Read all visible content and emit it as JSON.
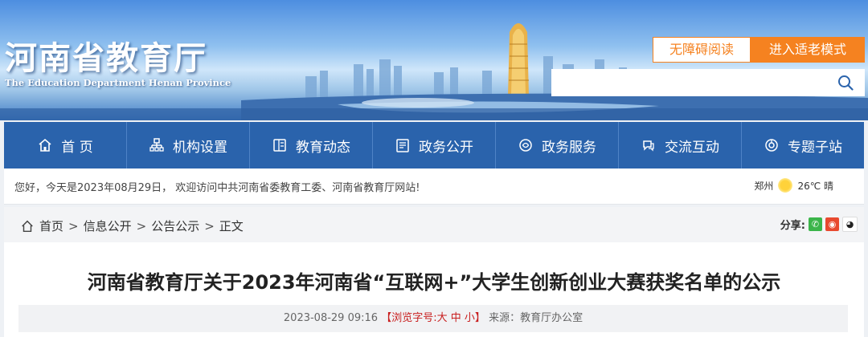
{
  "header": {
    "site_title": "河南省教育厅",
    "site_subtitle": "The Education Department Henan Province",
    "accessibility_button": "无障碍阅读",
    "elder_mode_button": "进入适老模式",
    "search_placeholder": ""
  },
  "nav": {
    "items": [
      {
        "label": "首 页",
        "icon": "home-icon"
      },
      {
        "label": "机构设置",
        "icon": "org-icon"
      },
      {
        "label": "教育动态",
        "icon": "news-icon"
      },
      {
        "label": "政务公开",
        "icon": "document-icon"
      },
      {
        "label": "政务服务",
        "icon": "service-icon"
      },
      {
        "label": "交流互动",
        "icon": "chat-icon"
      },
      {
        "label": "专题子站",
        "icon": "topic-icon"
      }
    ]
  },
  "welcome": {
    "text": "您好，今天是2023年08月29日， 欢迎访问中共河南省委教育工委、河南省教育厅网站!",
    "city": "郑州",
    "temperature": "26℃ 晴"
  },
  "breadcrumb": {
    "items": [
      "首页",
      "信息公开",
      "公告公示",
      "正文"
    ],
    "separator": ">",
    "share_label": "分享:"
  },
  "article": {
    "title": "河南省教育厅关于2023年河南省“互联网+”大学生创新创业大赛获奖名单的公示",
    "date": "2023-08-29 09:16",
    "font_size_open": "【浏览字号:",
    "font_large": "大",
    "font_medium": "中",
    "font_small": "小",
    "font_size_close": "】",
    "source": "来源：教育厅办公室"
  },
  "colors": {
    "nav_blue": "#2a63ac",
    "accent_orange": "#f58220",
    "meta_red": "#c81e1e"
  }
}
